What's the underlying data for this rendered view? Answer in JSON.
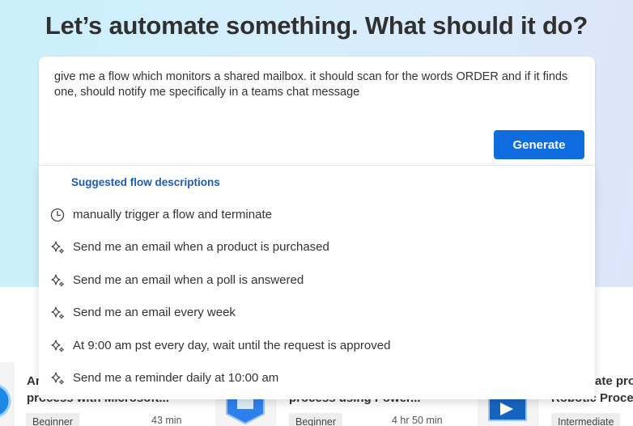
{
  "headline": "Let’s automate something. What should it do?",
  "prompt": {
    "value": "give me a flow which monitors a shared mailbox. it should scan for the words ORDER and if it finds one, should notify me specifically in a teams chat message",
    "generate_label": "Generate"
  },
  "suggestions": {
    "heading": "Suggested flow descriptions",
    "items": [
      {
        "label": "manually trigger a flow and terminate",
        "icon": "history-icon"
      },
      {
        "label": "Send me an email when a product is purchased",
        "icon": "sparkle-icon"
      },
      {
        "label": "Send me an email when a poll is answered",
        "icon": "sparkle-icon"
      },
      {
        "label": "Send me an email every week",
        "icon": "sparkle-icon"
      },
      {
        "label": "At 9:00 am pst every day, wait until the request is approved",
        "icon": "sparkle-icon"
      },
      {
        "label": "Send me a reminder daily at 10:00 am",
        "icon": "sparkle-icon"
      }
    ]
  },
  "background_cards": [
    {
      "title_line1": "An",
      "title_line2": "process with Microsoft...",
      "level": "Beginner",
      "duration": "43 min"
    },
    {
      "title_line1": "",
      "title_line2": "process using Power...",
      "level": "Beginner",
      "duration": "4 hr 50 min"
    },
    {
      "title_line1": "ate proc",
      "title_line2": "Robotic Proces",
      "level": "Intermediate",
      "duration": ""
    }
  ],
  "colors": {
    "accent": "#0f6cde",
    "link": "#1a5fb4",
    "text": "#333333"
  }
}
